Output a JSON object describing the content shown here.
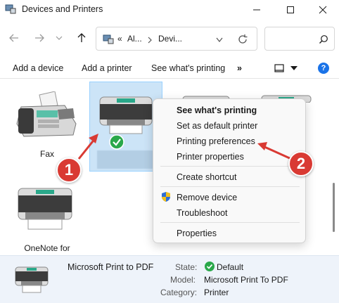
{
  "window": {
    "title": "Devices and Printers"
  },
  "address": {
    "prefix": "«",
    "crumb1": "Al...",
    "crumb2": "Devi..."
  },
  "toolbar": {
    "add_device": "Add a device",
    "add_printer": "Add a printer",
    "see_printing": "See what's printing",
    "more": "»",
    "help": "?"
  },
  "devices": [
    {
      "name": "Fax",
      "icon": "fax-icon"
    },
    {
      "name": "",
      "icon": "printer-icon",
      "selected": true,
      "default": true
    },
    {
      "name": "OneNote for",
      "icon": "printer-icon"
    }
  ],
  "context_menu": {
    "items": [
      {
        "label": "See what's printing",
        "bold": true
      },
      {
        "label": "Set as default printer"
      },
      {
        "label": "Printing preferences"
      },
      {
        "label": "Printer properties"
      },
      {
        "label": "Create shortcut"
      },
      {
        "label": "Remove device",
        "icon": "shield-icon"
      },
      {
        "label": "Troubleshoot"
      },
      {
        "label": "Properties"
      }
    ]
  },
  "details": {
    "device_name": "Microsoft Print to PDF",
    "state_label": "State:",
    "state_value": "Default",
    "model_label": "Model:",
    "model_value": "Microsoft Print To PDF",
    "category_label": "Category:",
    "category_value": "Printer"
  },
  "annotations": {
    "step1": "1",
    "step2": "2"
  },
  "colors": {
    "accent_red": "#d93a33",
    "selection_blue": "#cce4f7",
    "default_green": "#2aa84a",
    "help_blue": "#1a73e8"
  }
}
